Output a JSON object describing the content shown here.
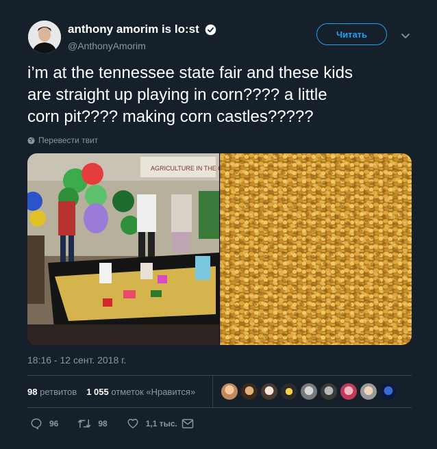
{
  "author": {
    "display_name": "anthony amorim is lo:st",
    "handle": "@AnthonyAmorim",
    "verified": true,
    "avatar_icon": "user-avatar"
  },
  "follow_button": {
    "label": "Читать"
  },
  "tweet": {
    "text": "i’m at the tennessee state fair and these kids\nare straight up playing in corn???? a little\ncorn pit???? making corn castles?????",
    "translate_label": "Перевести твит",
    "timestamp": "18:16 - 12 сент. 2018 г."
  },
  "media": [
    {
      "description": "kids playing in corn pit at fair"
    },
    {
      "description": "close-up of corn kernels"
    }
  ],
  "stats": {
    "retweets_count": "98",
    "retweets_label": "ретвитов",
    "likes_count": "1 055",
    "likes_label": "отметок «Нравится»",
    "likers": [
      "liker-1",
      "liker-2",
      "liker-3",
      "liker-4",
      "liker-5",
      "liker-6",
      "liker-7",
      "liker-8",
      "liker-9"
    ]
  },
  "actions": {
    "reply_count": "96",
    "retweet_count": "98",
    "like_count": "1,1 тыс.",
    "reply_icon": "reply-icon",
    "retweet_icon": "retweet-icon",
    "like_icon": "heart-icon",
    "dm_icon": "envelope-icon"
  },
  "colors": {
    "background": "#15202b",
    "accent": "#1da1f2",
    "secondary_text": "#8899a6",
    "divider": "#38444d"
  }
}
